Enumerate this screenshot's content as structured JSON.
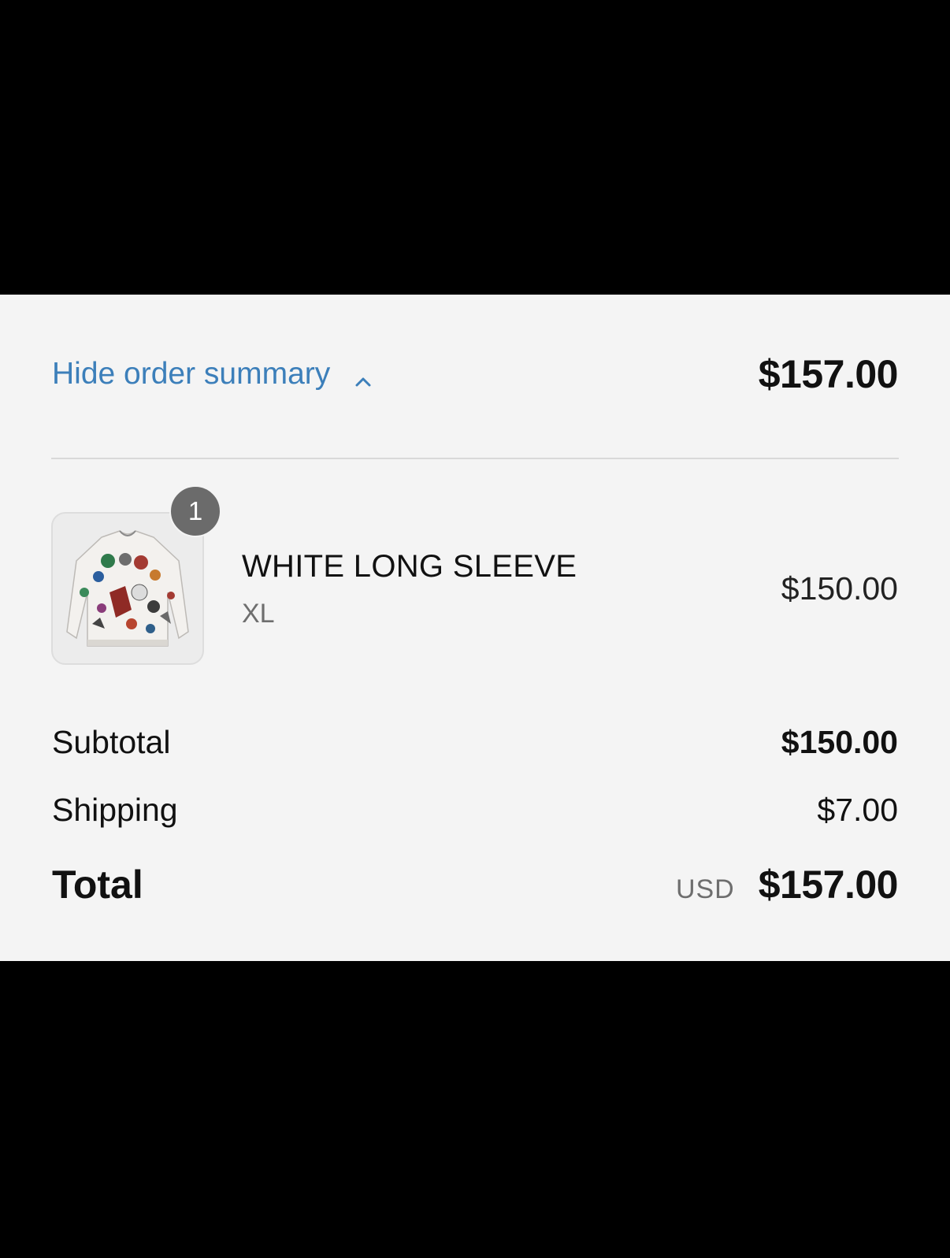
{
  "header": {
    "toggle_label": "Hide order summary",
    "toggle_icon": "chevron-up-icon",
    "total": "$157.00"
  },
  "line_items": [
    {
      "quantity": "1",
      "name": "WHITE LONG SLEEVE",
      "variant": "XL",
      "price": "$150.00",
      "image_icon": "long-sleeve-shirt-image"
    }
  ],
  "summary": {
    "subtotal_label": "Subtotal",
    "subtotal_value": "$150.00",
    "shipping_label": "Shipping",
    "shipping_value": "$7.00",
    "total_label": "Total",
    "currency": "USD",
    "total_value": "$157.00"
  },
  "colors": {
    "link": "#3c7fba",
    "panel_background": "#f4f4f4",
    "letterbox": "#000000",
    "badge": "#6b6b6b"
  }
}
